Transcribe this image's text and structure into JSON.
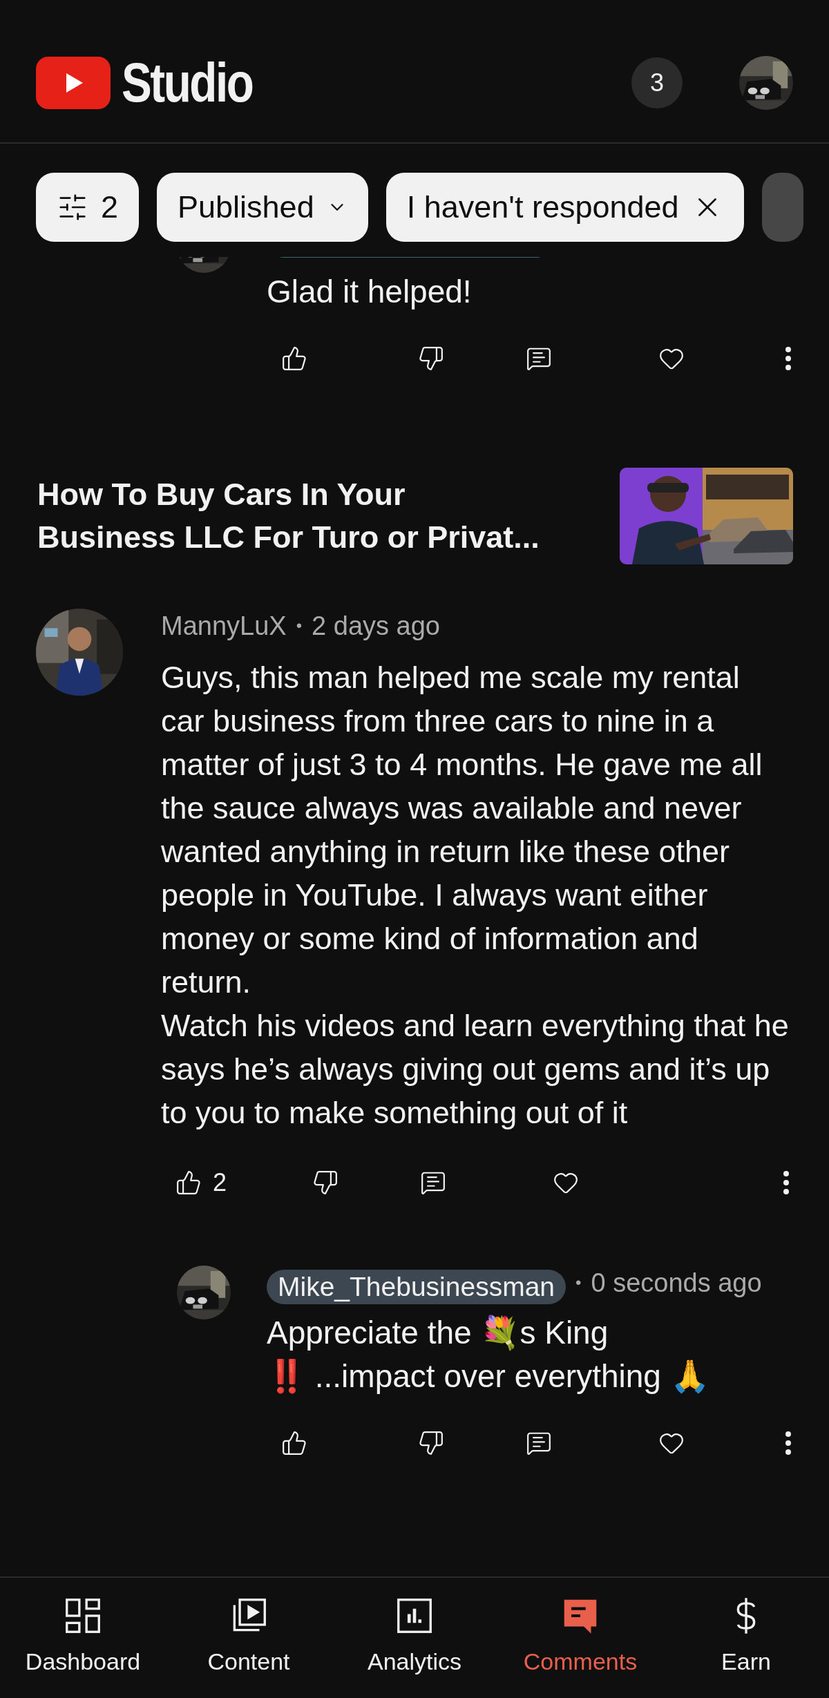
{
  "header": {
    "title": "Studio",
    "notification_count": "3"
  },
  "filters": [
    {
      "kind": "filter",
      "label": "2"
    },
    {
      "kind": "dropdown",
      "label": "Published"
    },
    {
      "kind": "removable",
      "label": "I haven't responded"
    },
    {
      "kind": "partial"
    }
  ],
  "previous_reply": {
    "body": "Glad it helped!"
  },
  "video": {
    "title": "How To Buy Cars In Your Business LLC For Turo or Privat..."
  },
  "comment": {
    "author": "MannyLuX",
    "separator": "•",
    "time": "2 days ago",
    "body": "Guys, this man helped me scale my rental car business from three cars to nine in a matter of just 3 to 4 months. He gave me all the sauce always was available and never wanted anything in return like these other people in YouTube. I always want either money or some kind of information and return.\nWatch his videos and learn everything that he says he’s always giving out gems and it’s up to you to make something out of it",
    "likes": "2"
  },
  "reply": {
    "author": "Mike_Thebusinessman",
    "separator": "•",
    "time": "0 seconds ago",
    "body": "Appreciate the 💐s King\n‼️ ...impact over everything 🙏"
  },
  "nav": [
    {
      "label": "Dashboard",
      "selected": false
    },
    {
      "label": "Content",
      "selected": false
    },
    {
      "label": "Analytics",
      "selected": false
    },
    {
      "label": "Comments",
      "selected": true
    },
    {
      "label": "Earn",
      "selected": false
    }
  ]
}
